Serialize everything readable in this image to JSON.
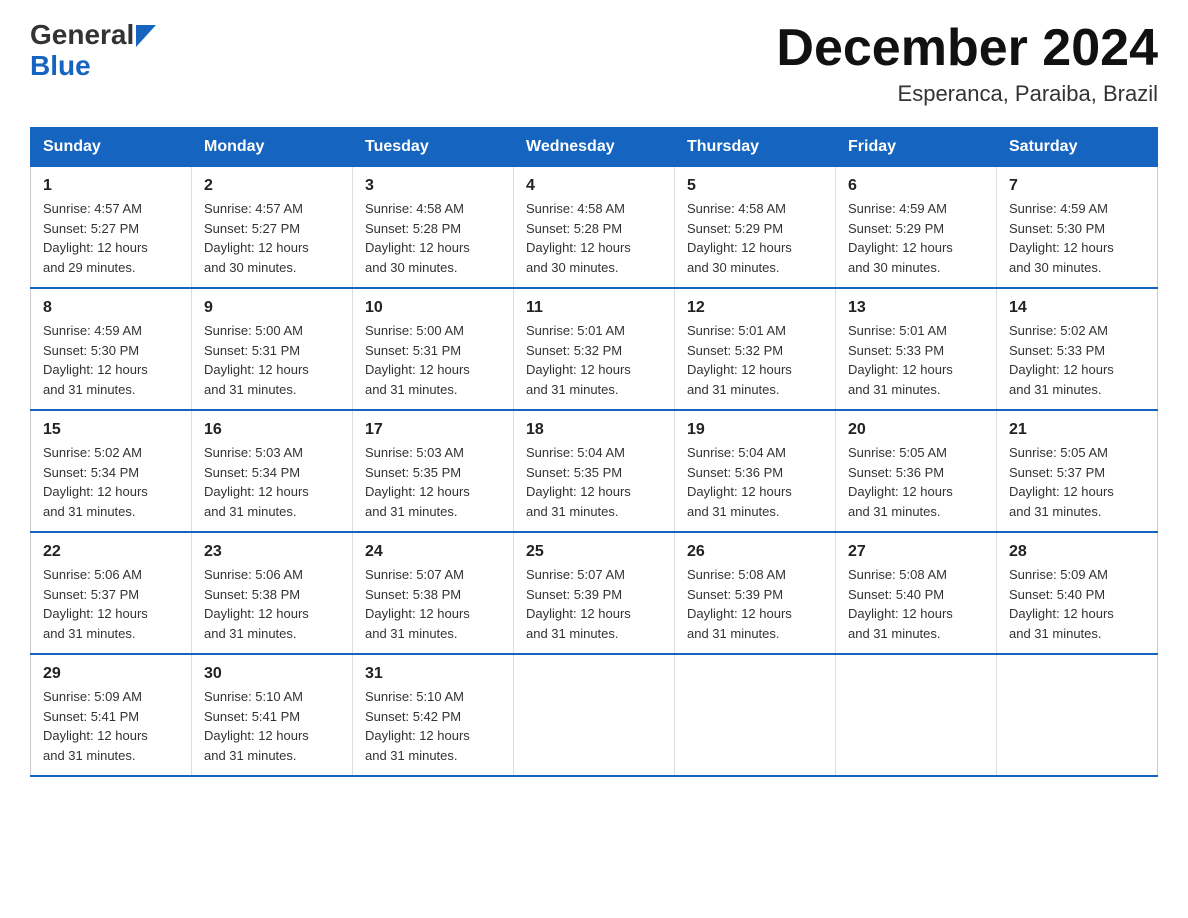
{
  "logo": {
    "general": "General",
    "blue": "Blue"
  },
  "title": {
    "month_year": "December 2024",
    "location": "Esperanca, Paraiba, Brazil"
  },
  "days_of_week": [
    "Sunday",
    "Monday",
    "Tuesday",
    "Wednesday",
    "Thursday",
    "Friday",
    "Saturday"
  ],
  "weeks": [
    [
      {
        "day": "1",
        "sunrise": "4:57 AM",
        "sunset": "5:27 PM",
        "daylight": "12 hours and 29 minutes."
      },
      {
        "day": "2",
        "sunrise": "4:57 AM",
        "sunset": "5:27 PM",
        "daylight": "12 hours and 30 minutes."
      },
      {
        "day": "3",
        "sunrise": "4:58 AM",
        "sunset": "5:28 PM",
        "daylight": "12 hours and 30 minutes."
      },
      {
        "day": "4",
        "sunrise": "4:58 AM",
        "sunset": "5:28 PM",
        "daylight": "12 hours and 30 minutes."
      },
      {
        "day": "5",
        "sunrise": "4:58 AM",
        "sunset": "5:29 PM",
        "daylight": "12 hours and 30 minutes."
      },
      {
        "day": "6",
        "sunrise": "4:59 AM",
        "sunset": "5:29 PM",
        "daylight": "12 hours and 30 minutes."
      },
      {
        "day": "7",
        "sunrise": "4:59 AM",
        "sunset": "5:30 PM",
        "daylight": "12 hours and 30 minutes."
      }
    ],
    [
      {
        "day": "8",
        "sunrise": "4:59 AM",
        "sunset": "5:30 PM",
        "daylight": "12 hours and 31 minutes."
      },
      {
        "day": "9",
        "sunrise": "5:00 AM",
        "sunset": "5:31 PM",
        "daylight": "12 hours and 31 minutes."
      },
      {
        "day": "10",
        "sunrise": "5:00 AM",
        "sunset": "5:31 PM",
        "daylight": "12 hours and 31 minutes."
      },
      {
        "day": "11",
        "sunrise": "5:01 AM",
        "sunset": "5:32 PM",
        "daylight": "12 hours and 31 minutes."
      },
      {
        "day": "12",
        "sunrise": "5:01 AM",
        "sunset": "5:32 PM",
        "daylight": "12 hours and 31 minutes."
      },
      {
        "day": "13",
        "sunrise": "5:01 AM",
        "sunset": "5:33 PM",
        "daylight": "12 hours and 31 minutes."
      },
      {
        "day": "14",
        "sunrise": "5:02 AM",
        "sunset": "5:33 PM",
        "daylight": "12 hours and 31 minutes."
      }
    ],
    [
      {
        "day": "15",
        "sunrise": "5:02 AM",
        "sunset": "5:34 PM",
        "daylight": "12 hours and 31 minutes."
      },
      {
        "day": "16",
        "sunrise": "5:03 AM",
        "sunset": "5:34 PM",
        "daylight": "12 hours and 31 minutes."
      },
      {
        "day": "17",
        "sunrise": "5:03 AM",
        "sunset": "5:35 PM",
        "daylight": "12 hours and 31 minutes."
      },
      {
        "day": "18",
        "sunrise": "5:04 AM",
        "sunset": "5:35 PM",
        "daylight": "12 hours and 31 minutes."
      },
      {
        "day": "19",
        "sunrise": "5:04 AM",
        "sunset": "5:36 PM",
        "daylight": "12 hours and 31 minutes."
      },
      {
        "day": "20",
        "sunrise": "5:05 AM",
        "sunset": "5:36 PM",
        "daylight": "12 hours and 31 minutes."
      },
      {
        "day": "21",
        "sunrise": "5:05 AM",
        "sunset": "5:37 PM",
        "daylight": "12 hours and 31 minutes."
      }
    ],
    [
      {
        "day": "22",
        "sunrise": "5:06 AM",
        "sunset": "5:37 PM",
        "daylight": "12 hours and 31 minutes."
      },
      {
        "day": "23",
        "sunrise": "5:06 AM",
        "sunset": "5:38 PM",
        "daylight": "12 hours and 31 minutes."
      },
      {
        "day": "24",
        "sunrise": "5:07 AM",
        "sunset": "5:38 PM",
        "daylight": "12 hours and 31 minutes."
      },
      {
        "day": "25",
        "sunrise": "5:07 AM",
        "sunset": "5:39 PM",
        "daylight": "12 hours and 31 minutes."
      },
      {
        "day": "26",
        "sunrise": "5:08 AM",
        "sunset": "5:39 PM",
        "daylight": "12 hours and 31 minutes."
      },
      {
        "day": "27",
        "sunrise": "5:08 AM",
        "sunset": "5:40 PM",
        "daylight": "12 hours and 31 minutes."
      },
      {
        "day": "28",
        "sunrise": "5:09 AM",
        "sunset": "5:40 PM",
        "daylight": "12 hours and 31 minutes."
      }
    ],
    [
      {
        "day": "29",
        "sunrise": "5:09 AM",
        "sunset": "5:41 PM",
        "daylight": "12 hours and 31 minutes."
      },
      {
        "day": "30",
        "sunrise": "5:10 AM",
        "sunset": "5:41 PM",
        "daylight": "12 hours and 31 minutes."
      },
      {
        "day": "31",
        "sunrise": "5:10 AM",
        "sunset": "5:42 PM",
        "daylight": "12 hours and 31 minutes."
      },
      null,
      null,
      null,
      null
    ]
  ],
  "labels": {
    "sunrise": "Sunrise:",
    "sunset": "Sunset:",
    "daylight": "Daylight:"
  }
}
